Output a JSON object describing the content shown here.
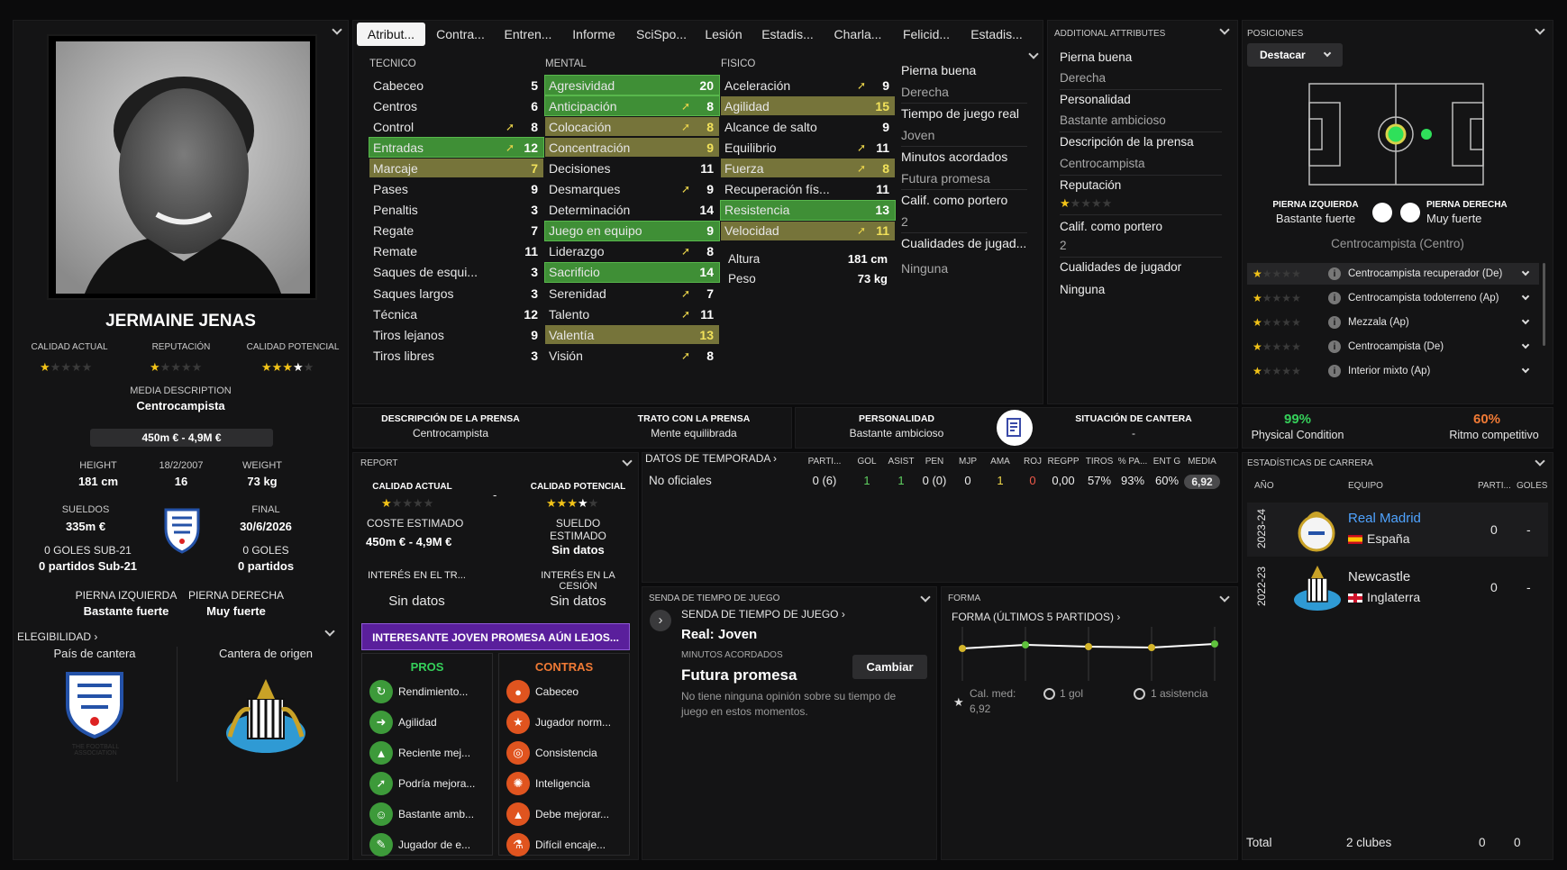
{
  "player": {
    "name": "JERMAINE JENAS",
    "ca_label": "CALIDAD ACTUAL",
    "rep_label": "REPUTACIÓN",
    "pa_label": "CALIDAD POTENCIAL",
    "media_desc_label": "MEDIA DESCRIPTION",
    "media_desc": "Centrocampista",
    "value": "450m € - 4,9M €",
    "height_label": "HEIGHT",
    "height": "181 cm",
    "dob": "18/2/2007",
    "age": "16",
    "weight_label": "WEIGHT",
    "weight": "73 kg",
    "wage_label": "SUELDOS",
    "wage": "335m €",
    "end_label": "FINAL",
    "end": "30/6/2026",
    "u21_goals": "0 GOLES SUB-21",
    "u21_apps": "0 partidos Sub-21",
    "goals": "0 GOLES",
    "apps": "0 partidos",
    "left_foot_label": "PIERNA IZQUIERDA",
    "left_foot": "Bastante fuerte",
    "right_foot_label": "PIERNA DERECHA",
    "right_foot": "Muy fuerte",
    "elig_label": "ELEGIBILIDAD",
    "nation_label": "País de cantera",
    "club_label": "Cantera de origen",
    "fa_text": "THE FOOTBALL ASSOCIATION",
    "ca_stars": 1,
    "rep_stars": 0.5,
    "pa_stars": 3.5
  },
  "tabs": [
    "Atribut...",
    "Contra...",
    "Entren...",
    "Informe",
    "SciSpo...",
    "Lesión",
    "Estadis...",
    "Charla...",
    "Felicid...",
    "Estadis..."
  ],
  "attributes": {
    "tecnico_label": "TECNICO",
    "mental_label": "MENTAL",
    "fisico_label": "FISICO",
    "tecnico": [
      {
        "name": "Cabeceo",
        "value": "5"
      },
      {
        "name": "Centros",
        "value": "6"
      },
      {
        "name": "Control",
        "value": "8",
        "arrow": true
      },
      {
        "name": "Entradas",
        "value": "12",
        "arrow": true,
        "hl": "g"
      },
      {
        "name": "Marcaje",
        "value": "7",
        "hl": "o"
      },
      {
        "name": "Pases",
        "value": "9"
      },
      {
        "name": "Penaltis",
        "value": "3"
      },
      {
        "name": "Regate",
        "value": "7"
      },
      {
        "name": "Remate",
        "value": "11"
      },
      {
        "name": "Saques de esqui...",
        "value": "3"
      },
      {
        "name": "Saques largos",
        "value": "3"
      },
      {
        "name": "Técnica",
        "value": "12"
      },
      {
        "name": "Tiros lejanos",
        "value": "9"
      },
      {
        "name": "Tiros libres",
        "value": "3"
      }
    ],
    "mental": [
      {
        "name": "Agresividad",
        "value": "20",
        "hl": "g"
      },
      {
        "name": "Anticipación",
        "value": "8",
        "arrow": true,
        "hl": "g"
      },
      {
        "name": "Colocación",
        "value": "8",
        "arrow": true,
        "hl": "o"
      },
      {
        "name": "Concentración",
        "value": "9",
        "hl": "o"
      },
      {
        "name": "Decisiones",
        "value": "11"
      },
      {
        "name": "Desmarques",
        "value": "9",
        "arrow": true
      },
      {
        "name": "Determinación",
        "value": "14"
      },
      {
        "name": "Juego en equipo",
        "value": "9",
        "hl": "g"
      },
      {
        "name": "Liderazgo",
        "value": "8",
        "arrow": true
      },
      {
        "name": "Sacrificio",
        "value": "14",
        "hl": "g"
      },
      {
        "name": "Serenidad",
        "value": "7",
        "arrow": true
      },
      {
        "name": "Talento",
        "value": "11",
        "arrow": true
      },
      {
        "name": "Valentía",
        "value": "13",
        "hl": "o"
      },
      {
        "name": "Visión",
        "value": "8",
        "arrow": true
      }
    ],
    "fisico": [
      {
        "name": "Aceleración",
        "value": "9",
        "arrow": true
      },
      {
        "name": "Agilidad",
        "value": "15",
        "hl": "o"
      },
      {
        "name": "Alcance de salto",
        "value": "9"
      },
      {
        "name": "Equilibrio",
        "value": "11",
        "arrow": true
      },
      {
        "name": "Fuerza",
        "value": "8",
        "arrow": true,
        "hl": "o"
      },
      {
        "name": "Recuperación fís...",
        "value": "11"
      },
      {
        "name": "Resistencia",
        "value": "13",
        "hl": "g"
      },
      {
        "name": "Velocidad",
        "value": "11",
        "arrow": true,
        "hl": "o"
      }
    ],
    "altura_label": "Altura",
    "altura": "181 cm",
    "peso_label": "Peso",
    "peso": "73 kg"
  },
  "info_col": [
    "Pierna buena",
    "Derecha",
    "Tiempo de juego real",
    "Joven",
    "Minutos acordados",
    "Futura promesa",
    "Calif. como portero",
    "2",
    "Cualidades de jugad...",
    "Ninguna"
  ],
  "additional": {
    "title": "ADDITIONAL ATTRIBUTES",
    "items": [
      "Pierna buena",
      "Derecha",
      "Personalidad",
      "Bastante ambicioso",
      "Descripción de la prensa",
      "Centrocampista",
      "Reputación",
      "Calif. como portero",
      "2",
      "Cualidades de jugador",
      "Ninguna"
    ]
  },
  "positions": {
    "title": "POSICIONES",
    "button": "Destacar",
    "left_foot_label": "PIERNA IZQUIERDA",
    "left_foot": "Bastante fuerte",
    "right_foot_label": "PIERNA DERECHA",
    "right_foot": "Muy fuerte",
    "main": "Centrocampista (Centro)",
    "roles": [
      {
        "name": "Centrocampista recuperador (De)",
        "stars": 1
      },
      {
        "name": "Centrocampista todoterreno (Ap)",
        "stars": 1
      },
      {
        "name": "Mezzala (Ap)",
        "stars": 1
      },
      {
        "name": "Centrocampista (De)",
        "stars": 1
      },
      {
        "name": "Interior mixto (Ap)",
        "stars": 1
      }
    ]
  },
  "press": {
    "desc_label": "DESCRIPCIÓN DE LA PRENSA",
    "desc": "Centrocampista",
    "trato_label": "TRATO CON LA PRENSA",
    "trato": "Mente equilibrada",
    "pers_label": "PERSONALIDAD",
    "pers": "Bastante ambicioso",
    "sit_label": "SITUACIÓN DE CANTERA",
    "sit": "-"
  },
  "condition": {
    "phys": "99%",
    "phys_label": "Physical Condition",
    "ritmo": "60%",
    "ritmo_label": "Ritmo competitivo"
  },
  "report": {
    "title": "REPORT",
    "ca_label": "CALIDAD ACTUAL",
    "pa_label": "CALIDAD POTENCIAL",
    "dash": "-",
    "cost_label": "COSTE ESTIMADO",
    "cost": "450m € - 4,9M €",
    "wage_label": "SUELDO ESTIMADO",
    "wage": "Sin datos",
    "interest_tr_label": "INTERÉS EN EL TR...",
    "interest_tr": "Sin datos",
    "interest_loan_label": "INTERÉS EN LA CESIÓN",
    "interest_loan": "Sin datos",
    "banner": "INTERESANTE JOVEN PROMESA AÚN LEJOS...",
    "pros_label": "PROS",
    "cons_label": "CONTRAS",
    "pros": [
      "Rendimiento...",
      "Agilidad",
      "Reciente mej...",
      "Podría mejora...",
      "Bastante amb...",
      "Jugador de e..."
    ],
    "cons": [
      "Cabeceo",
      "Jugador norm...",
      "Consistencia",
      "Inteligencia",
      "Debe mejorar...",
      "Difícil encaje..."
    ]
  },
  "season": {
    "title": "DATOS DE TEMPORADA",
    "headers": [
      "PARTI...",
      "GOL",
      "ASIST",
      "PEN",
      "MJP",
      "AMA",
      "ROJ",
      "REGPP",
      "TIROS",
      "% PA...",
      "ENT G",
      "MEDIA"
    ],
    "row_label": "No oficiales",
    "row": [
      "0 (6)",
      "1",
      "1",
      "0 (0)",
      "0",
      "1",
      "0",
      "0,00",
      "57%",
      "93%",
      "60%",
      "6,92"
    ]
  },
  "playtime": {
    "title": "SENDA DE TIEMPO DE JUEGO",
    "sub": "SENDA DE TIEMPO DE JUEGO",
    "real": "Real: Joven",
    "min_label": "MINUTOS ACORDADOS",
    "button": "Cambiar",
    "min": "Futura promesa",
    "note": "No tiene ninguna opinión sobre su tiempo de juego en estos momentos."
  },
  "form": {
    "title": "FORMA",
    "sub": "FORMA (ÚLTIMOS 5 PARTIDOS)",
    "avg_label": "Cal. med:",
    "avg": "6,92",
    "goals": "1 gol",
    "assists": "1 asistencia"
  },
  "career": {
    "title": "ESTADÍSTICAS DE CARRERA",
    "h_year": "AÑO",
    "h_team": "EQUIPO",
    "h_apps": "PARTI...",
    "h_goals": "GOLES",
    "rows": [
      {
        "year": "2023-24",
        "team": "Real Madrid",
        "country": "España",
        "apps": "0",
        "goals": "-"
      },
      {
        "year": "2022-23",
        "team": "Newcastle",
        "country": "Inglaterra",
        "apps": "0",
        "goals": "-"
      }
    ],
    "total_label": "Total",
    "total_clubs": "2 clubes",
    "total_apps": "0",
    "total_goals": "0"
  },
  "colors": {
    "green": "#3f8f36",
    "olive": "#76743a",
    "purple": "#5a1f9c",
    "accent_green": "#35d05a",
    "accent_red": "#f07a35",
    "link": "#4fa3ff"
  }
}
